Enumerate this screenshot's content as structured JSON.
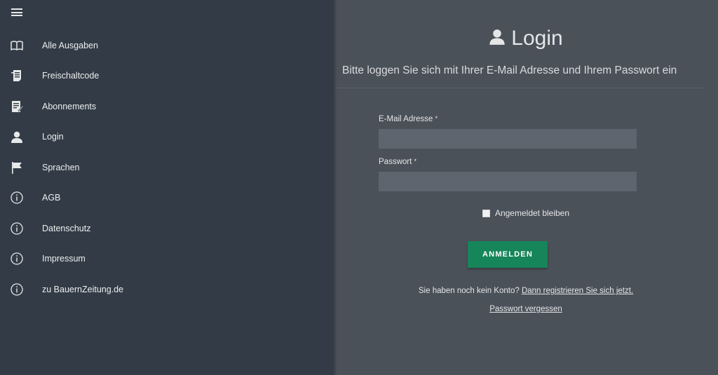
{
  "sidebar": {
    "menu_icon": "hamburger-icon",
    "items": [
      {
        "label": "Alle Ausgaben",
        "icon": "book-icon"
      },
      {
        "label": "Freischaltcode",
        "icon": "receipt-icon"
      },
      {
        "label": "Abonnements",
        "icon": "document-edit-icon"
      },
      {
        "label": "Login",
        "icon": "user-icon"
      },
      {
        "label": "Sprachen",
        "icon": "flag-icon"
      },
      {
        "label": "AGB",
        "icon": "info-icon"
      },
      {
        "label": "Datenschutz",
        "icon": "info-icon"
      },
      {
        "label": "Impressum",
        "icon": "info-icon"
      },
      {
        "label": "zu BauernZeitung.de",
        "icon": "info-icon"
      }
    ]
  },
  "main": {
    "title": "Login",
    "title_icon": "user-icon",
    "subtitle": "Bitte loggen Sie sich mit Ihrer E-Mail Adresse und Ihrem Passwort ein",
    "email_label": "E-Mail Adresse",
    "email_value": "",
    "password_label": "Passwort",
    "password_value": "",
    "required_marker": "*",
    "remember_label": "Angemeldet bleiben",
    "remember_checked": false,
    "submit_label": "ANMELDEN",
    "register_text": "Sie haben noch kein Konto?",
    "register_link": "Dann registrieren Sie sich jetzt.",
    "forgot_link": "Passwort vergessen"
  },
  "colors": {
    "sidebar_bg": "#333c46",
    "main_bg": "#4b5159",
    "input_bg": "#5f656e",
    "button_bg": "#16855a"
  }
}
